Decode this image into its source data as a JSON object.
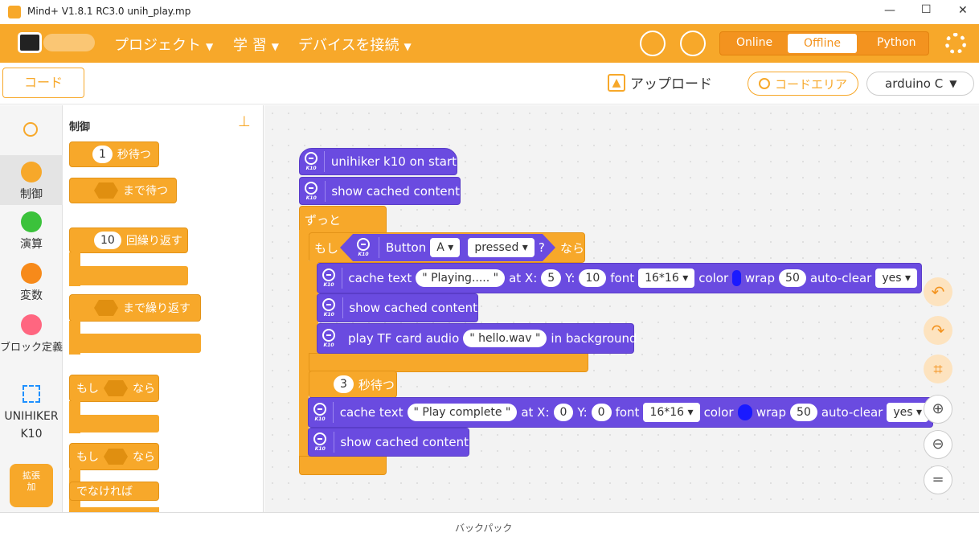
{
  "window": {
    "title": "Mind+ V1.8.1 RC3.0   unih_play.mp",
    "minimize": "—",
    "maximize": "☐",
    "close": "✕"
  },
  "menu": {
    "project": "プロジェクト",
    "learn": "学 習",
    "connect": "デバイスを接続",
    "caret": "▼"
  },
  "modes": {
    "online": "Online",
    "offline": "Offline",
    "python": "Python"
  },
  "toolbar": {
    "code_button": "コード",
    "upload": "アップロード",
    "code_area": "コードエリア",
    "board": "arduino C"
  },
  "sidebar": {
    "items": [
      "制御",
      "演算",
      "変数",
      "ブロック定義",
      "UNIHIKER\nK10"
    ],
    "extension": "拡張",
    "extension_add": "加"
  },
  "palette": {
    "title": "制御",
    "wait": {
      "value": "1",
      "label": "秒待つ"
    },
    "wait_until": "まで待つ",
    "repeat": {
      "value": "10",
      "label": "回繰り返す"
    },
    "repeat_until": "まで繰り返す",
    "if_label": "もし",
    "then_label": "なら",
    "else_label": "でなければ"
  },
  "blocks": {
    "k10_label": "K10",
    "on_start": "unihiker k10 on start",
    "show_cached": "show cached content",
    "forever": "ずっと",
    "if": "もし",
    "button": "Button",
    "button_value": "A",
    "pressed": "pressed",
    "question": "?",
    "then": "なら",
    "cache_text": "cache text",
    "text1": "\" Playing..... \"",
    "at_x": "at X:",
    "x1": "5",
    "y_label": "Y:",
    "y1": "10",
    "font": "font",
    "font_value": "16*16",
    "color": "color",
    "wrap": "wrap",
    "wrap_value": "50",
    "auto_clear": "auto-clear",
    "yes": "yes",
    "play_tf": "play TF card audio",
    "audio_file": "\" hello.wav \"",
    "in_background": "in background",
    "wait_value": "3",
    "wait_label": "秒待つ",
    "text2": "\" Play complete \"",
    "x2": "0",
    "y2": "0"
  },
  "footer": {
    "backpack": "バックパック"
  },
  "colors": {
    "accent": "#f7a82a",
    "block_blue": "#6a4be0",
    "swatch": "#1a1aff"
  }
}
